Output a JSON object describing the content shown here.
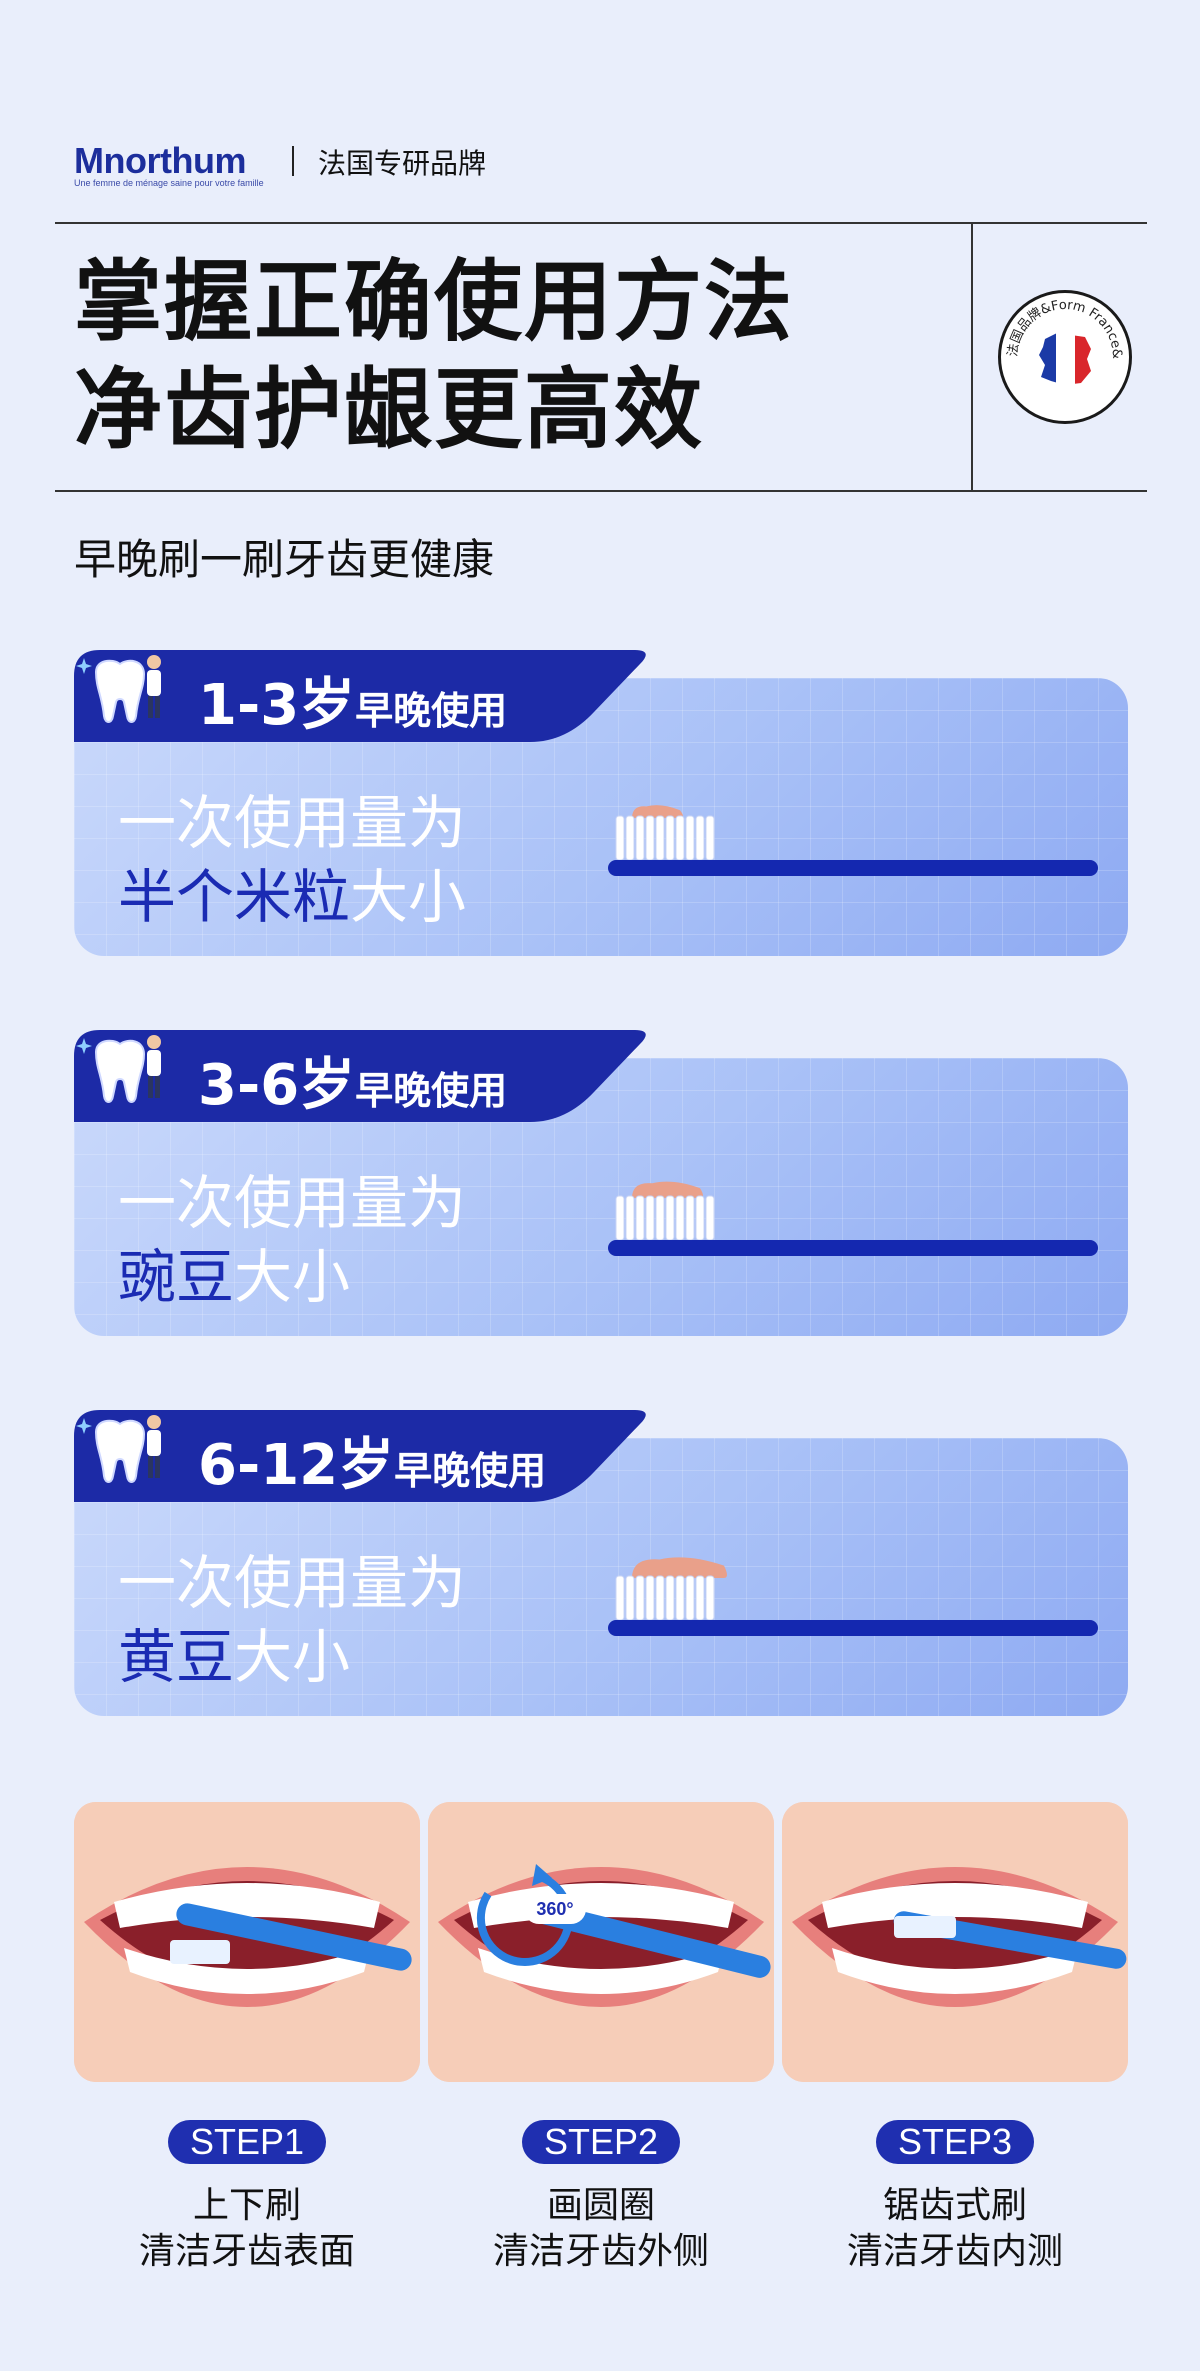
{
  "brand": {
    "logo": "Mnorthum",
    "logo_tagline": "Une femme de ménage saine pour votre famille",
    "note": "法国专研品牌"
  },
  "headline": {
    "line1": "掌握正确使用方法",
    "line2": "净齿护龈更高效"
  },
  "seal_text": "法国品牌&Form France&",
  "subheadline": "早晚刷一刷牙齿更健康",
  "cards": [
    {
      "age": "1-3岁",
      "usage": "早晚使用",
      "line1": "一次使用量为",
      "line2_highlight": "半个米粒",
      "line2_rest": "大小",
      "paste_amount": 0.35
    },
    {
      "age": "3-6岁",
      "usage": "早晚使用",
      "line1": "一次使用量为",
      "line2_highlight": "豌豆",
      "line2_rest": "大小",
      "paste_amount": 0.6
    },
    {
      "age": "6-12岁",
      "usage": "早晚使用",
      "line1": "一次使用量为",
      "line2_highlight": "黄豆",
      "line2_rest": "大小",
      "paste_amount": 0.9
    }
  ],
  "steps": [
    {
      "badge": "STEP1",
      "title": "上下刷",
      "desc": "清洁牙齿表面"
    },
    {
      "badge": "STEP2",
      "title": "画圆圈",
      "desc": "清洁牙齿外侧",
      "arrow_label": "360°"
    },
    {
      "badge": "STEP3",
      "title": "锯齿式刷",
      "desc": "清洁牙齿内测"
    }
  ],
  "colors": {
    "brand_blue": "#1a2bb3",
    "tab_blue": "#1c2aa6",
    "background": "#e9eefb",
    "card_gradient_start": "#cad9fb",
    "card_gradient_end": "#8eaaf2"
  },
  "icons": [
    "tooth-mascot-icon",
    "toothbrush-icon",
    "france-map-icon",
    "sparkle-icon"
  ]
}
